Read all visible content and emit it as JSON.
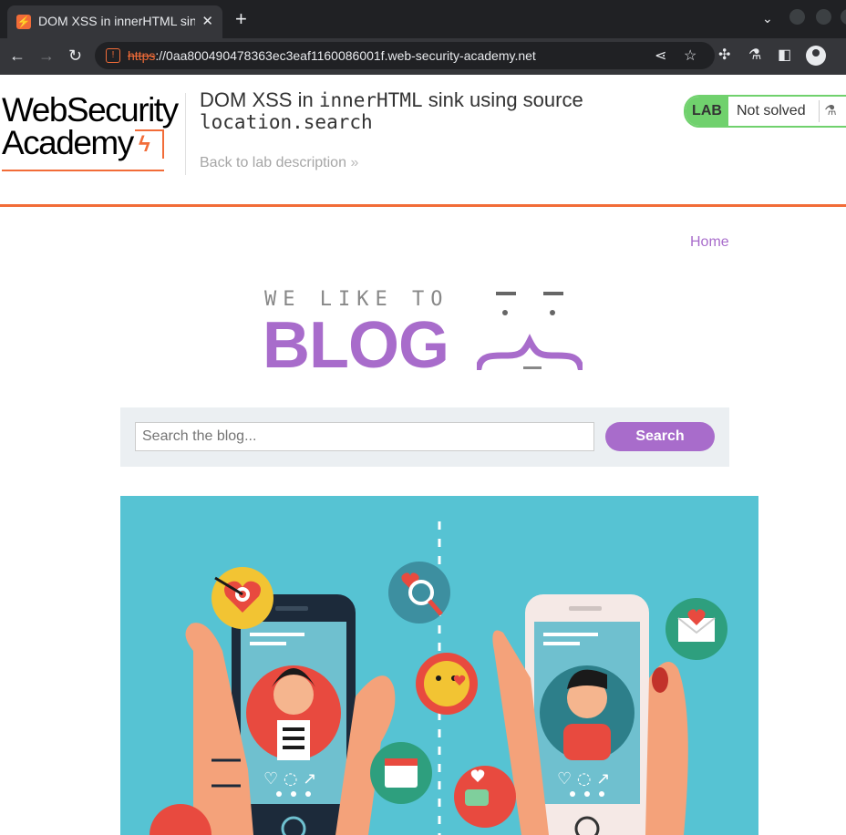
{
  "browser": {
    "tab_title": "DOM XSS in innerHTML sink using source location.search",
    "tab_close": "✕",
    "new_tab": "+",
    "url_scheme": "https",
    "url_rest": "://0aa800490478363ec3eaf1160086001f.web-security-academy.net"
  },
  "academy": {
    "logo_line1": "WebSecurity",
    "logo_line2": "Academy",
    "title_prefix": "DOM XSS in ",
    "title_code1": "innerHTML",
    "title_middle": " sink using source",
    "title_code2": "location.search",
    "back_link": "Back to lab description",
    "back_arrow": "»",
    "lab_label": "LAB",
    "lab_status": "Not solved"
  },
  "blog": {
    "home_link": "Home",
    "tagline": "WE LIKE TO",
    "wordmark": "BLOG",
    "search_placeholder": "Search the blog...",
    "search_button": "Search"
  },
  "colors": {
    "accent": "#a86ccb",
    "brand_orange": "#f26c38",
    "lab_green": "#70d16d",
    "hero_bg": "#56c3d3"
  }
}
